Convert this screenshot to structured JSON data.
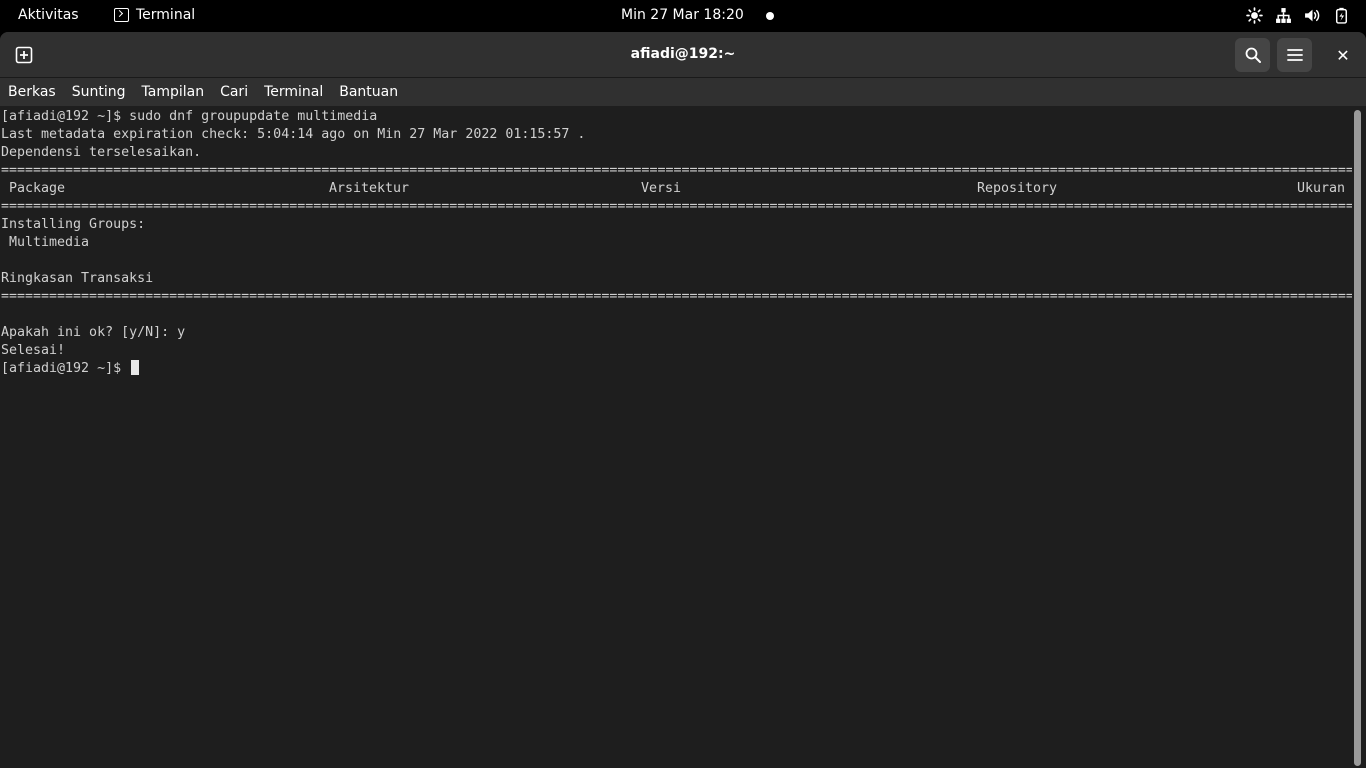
{
  "topbar": {
    "activities": "Aktivitas",
    "app_name": "Terminal",
    "clock": "Min 27 Mar  18:20",
    "tray_icons": [
      "brightness-icon",
      "network-icon",
      "volume-icon",
      "battery-icon"
    ]
  },
  "window": {
    "title": "afiadi@192:~",
    "new_tab_icon": "new-tab-icon",
    "search_icon": "search-icon",
    "menu_icon": "hamburger-menu-icon",
    "close_label": "✕"
  },
  "menubar": {
    "items": [
      "Berkas",
      "Sunting",
      "Tampilan",
      "Cari",
      "Terminal",
      "Bantuan"
    ]
  },
  "terminal": {
    "line1": "[afiadi@192 ~]$ sudo dnf groupupdate multimedia",
    "line2": "Last metadata expiration check: 5:04:14 ago on Min 27 Mar 2022 01:15:57 .",
    "line3": "Dependensi terselesaikan.",
    "separator": "====================================================================================================================================================================================",
    "header": {
      "package": "Package",
      "arch": "Arsitektur",
      "version": "Versi",
      "repo": "Repository",
      "size": "Ukuran"
    },
    "line_groups": "Installing Groups:",
    "line_multimedia": " Multimedia",
    "line_summary": "Ringkasan Transaksi",
    "line_confirm": "Apakah ini ok? [y/N]: y",
    "line_done": "Selesai!",
    "prompt": "[afiadi@192 ~]$ "
  }
}
